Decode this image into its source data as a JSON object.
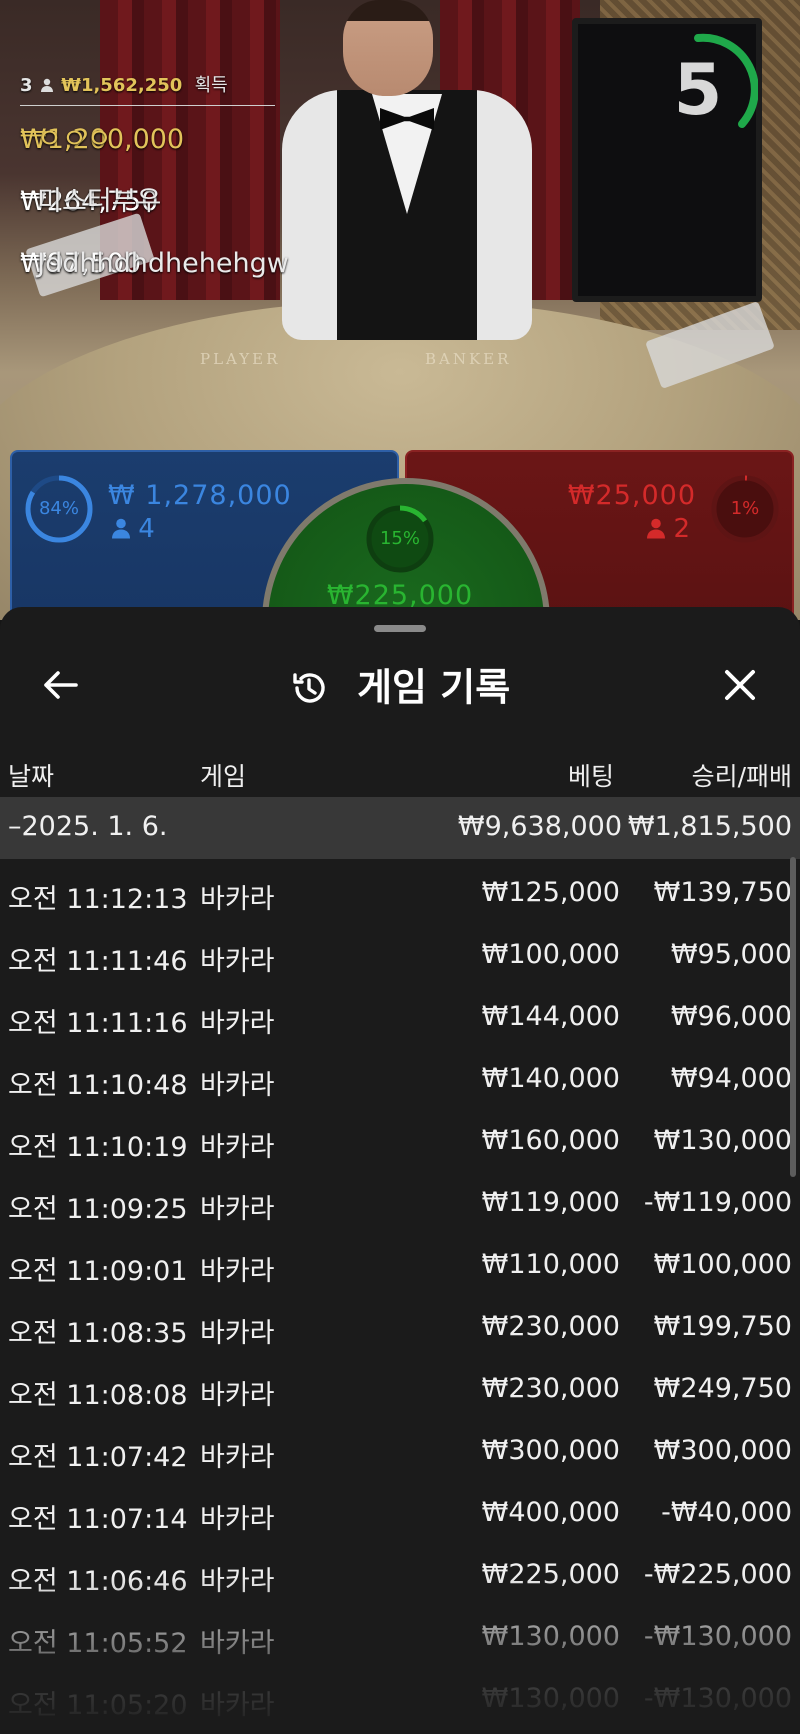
{
  "video": {
    "felt_player": "PLAYER",
    "felt_banker": "BANKER",
    "timer": "5",
    "winners": {
      "header_count": "3",
      "header_amount": "₩1,562,250",
      "header_label": "획득",
      "list": [
        {
          "amount": "₩1,200,000",
          "name": "ㅇㅇㅇ"
        },
        {
          "amount": "₩264,750",
          "name": "미스터부우"
        },
        {
          "amount": "₩97,500",
          "name": "Jddhhdhdhehehgw"
        }
      ]
    },
    "bets": {
      "player": {
        "percent": "84%",
        "amount": "₩ 1,278,000",
        "count": "4"
      },
      "tie": {
        "percent": "15%",
        "amount": "₩225,000"
      },
      "banker": {
        "percent": "1%",
        "amount": "₩25,000",
        "count": "2"
      }
    }
  },
  "sheet": {
    "title": "게임 기록",
    "columns": {
      "date": "날짜",
      "game": "게임",
      "bet": "베팅",
      "winloss": "승리/패배"
    },
    "date_group": {
      "date": "–2025. 1. 6.",
      "bet": "₩9,638,000",
      "winloss": "₩1,815,500"
    },
    "rows": [
      {
        "time": "오전 11:12:13",
        "game": "바카라",
        "bet": "₩125,000",
        "winloss": "₩139,750"
      },
      {
        "time": "오전 11:11:46",
        "game": "바카라",
        "bet": "₩100,000",
        "winloss": "₩95,000"
      },
      {
        "time": "오전 11:11:16",
        "game": "바카라",
        "bet": "₩144,000",
        "winloss": "₩96,000"
      },
      {
        "time": "오전 11:10:48",
        "game": "바카라",
        "bet": "₩140,000",
        "winloss": "₩94,000"
      },
      {
        "time": "오전 11:10:19",
        "game": "바카라",
        "bet": "₩160,000",
        "winloss": "₩130,000"
      },
      {
        "time": "오전 11:09:25",
        "game": "바카라",
        "bet": "₩119,000",
        "winloss": "-₩119,000"
      },
      {
        "time": "오전 11:09:01",
        "game": "바카라",
        "bet": "₩110,000",
        "winloss": "₩100,000"
      },
      {
        "time": "오전 11:08:35",
        "game": "바카라",
        "bet": "₩230,000",
        "winloss": "₩199,750"
      },
      {
        "time": "오전 11:08:08",
        "game": "바카라",
        "bet": "₩230,000",
        "winloss": "₩249,750"
      },
      {
        "time": "오전 11:07:42",
        "game": "바카라",
        "bet": "₩300,000",
        "winloss": "₩300,000"
      },
      {
        "time": "오전 11:07:14",
        "game": "바카라",
        "bet": "₩400,000",
        "winloss": "-₩40,000"
      },
      {
        "time": "오전 11:06:46",
        "game": "바카라",
        "bet": "₩225,000",
        "winloss": "-₩225,000"
      },
      {
        "time": "오전 11:05:52",
        "game": "바카라",
        "bet": "₩130,000",
        "winloss": "-₩130,000"
      },
      {
        "time": "오전 11:05:20",
        "game": "바카라",
        "bet": "₩130,000",
        "winloss": "-₩130,000"
      }
    ]
  },
  "icons": {
    "back": "arrow-left-icon",
    "history": "history-icon",
    "close": "close-icon",
    "person": "person-icon"
  },
  "colors": {
    "player_blue": "#2f74c8",
    "banker_red": "#c42323",
    "tie_green": "#22a82c",
    "gold": "#e2c35a",
    "sheet_bg": "#1b1b1b"
  }
}
